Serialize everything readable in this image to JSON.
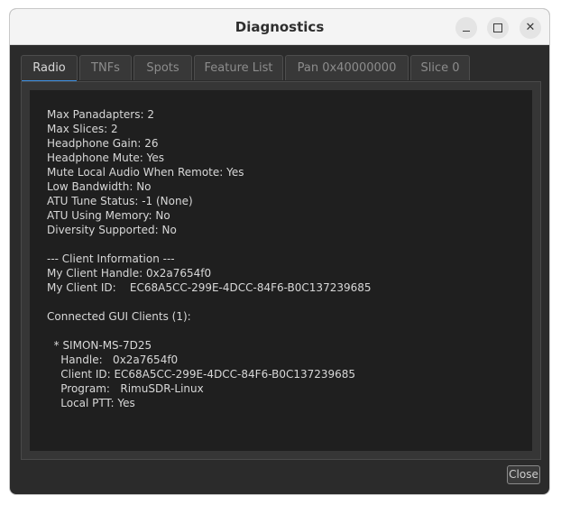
{
  "window": {
    "title": "Diagnostics"
  },
  "tabs": [
    {
      "label": "Radio",
      "active": true
    },
    {
      "label": "TNFs",
      "active": false
    },
    {
      "label": "Spots",
      "active": false
    },
    {
      "label": "Feature List",
      "active": false
    },
    {
      "label": "Pan 0x40000000",
      "active": false
    },
    {
      "label": "Slice 0",
      "active": false
    }
  ],
  "content": {
    "lines": [
      "Max Panadapters: 2",
      "Max Slices: 2",
      "Headphone Gain: 26",
      "Headphone Mute: Yes",
      "Mute Local Audio When Remote: Yes",
      "Low Bandwidth: No",
      "ATU Tune Status: -1 (None)",
      "ATU Using Memory: No",
      "Diversity Supported: No",
      "",
      "--- Client Information ---",
      "My Client Handle: 0x2a7654f0",
      "My Client ID:    EC68A5CC-299E-4DCC-84F6-B0C137239685",
      "",
      "Connected GUI Clients (1):",
      "",
      "  * SIMON-MS-7D25",
      "    Handle:   0x2a7654f0",
      "    Client ID: EC68A5CC-299E-4DCC-84F6-B0C137239685",
      "    Program:   RimuSDR-Linux",
      "    Local PTT: Yes"
    ]
  },
  "footer": {
    "close_label": "Close"
  },
  "colors": {
    "accent": "#3d8ee0",
    "panel": "#1f1f1f",
    "window_bg": "#2b2b2b"
  }
}
